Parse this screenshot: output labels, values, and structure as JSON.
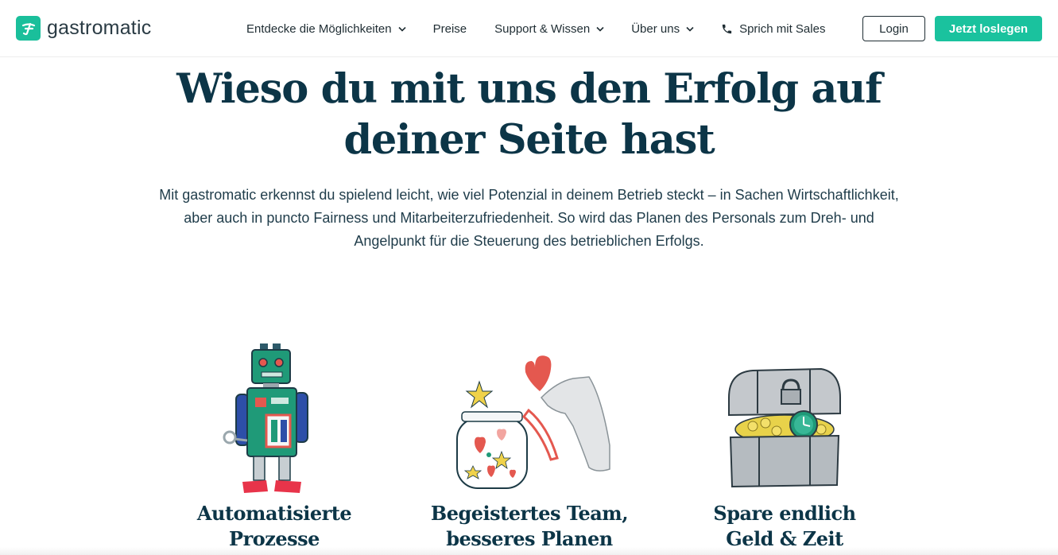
{
  "brand": {
    "name": "gastromatic",
    "accent": "#1ac29e",
    "text_color": "#0c3547"
  },
  "nav": {
    "items": [
      {
        "label": "Entdecke die Möglichkeiten",
        "has_dropdown": true
      },
      {
        "label": "Preise",
        "has_dropdown": false
      },
      {
        "label": "Support & Wissen",
        "has_dropdown": true
      },
      {
        "label": "Über uns",
        "has_dropdown": true
      },
      {
        "label": "Sprich mit Sales",
        "icon": "phone-icon"
      }
    ],
    "login_label": "Login",
    "start_label": "Jetzt loslegen"
  },
  "hero": {
    "title_line1": "Wieso du mit uns den Erfolg auf",
    "title_line2": "deiner Seite hast",
    "text_line1": "Mit gastromatic erkennst du spielend leicht, wie viel Potenzial in deinem Betrieb steckt – in Sachen Wirtschaftlichkeit,",
    "text_line2": "aber auch in puncto Fairness und Mitarbeiterzufriedenheit. So wird das Planen des Personals zum Dreh- und",
    "text_line3": "Angelpunkt für die Steuerung des betrieblichen Erfolgs."
  },
  "features": [
    {
      "title_line1": "Automatisierte",
      "title_line2": "Prozesse",
      "illustration": "robot-illustration"
    },
    {
      "title_line1": "Begeistertes Team,",
      "title_line2": "besseres Planen",
      "illustration": "heart-jar-illustration"
    },
    {
      "title_line1": "Spare endlich",
      "title_line2": "Geld & Zeit",
      "illustration": "treasure-chest-illustration"
    }
  ]
}
